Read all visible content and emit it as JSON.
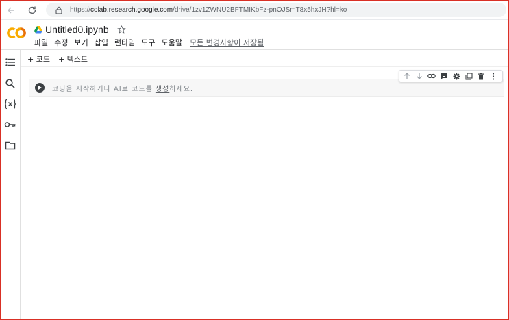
{
  "browser": {
    "url_prefix": "https://",
    "url_host": "colab.research.google.com",
    "url_path": "/drive/1zv1ZWNU2BFTMIKbFz-pnOJSmT8x5hxJH?hl=ko"
  },
  "header": {
    "file_title": "Untitled0.ipynb",
    "menu": [
      "파일",
      "수정",
      "보기",
      "삽입",
      "런타임",
      "도구",
      "도움말"
    ],
    "saved_status": "모든 변경사항이 저장됨"
  },
  "toolbar": {
    "add_code": "+ 코드",
    "add_text": "+ 텍스트"
  },
  "cell": {
    "placeholder_before": "코딩을 시작하거나 AI로 코드를 ",
    "placeholder_link": "생성",
    "placeholder_after": "하세요."
  },
  "colors": {
    "logo_orange": "#F9AB00",
    "logo_dark": "#E8710A",
    "frame": "#D93025"
  }
}
